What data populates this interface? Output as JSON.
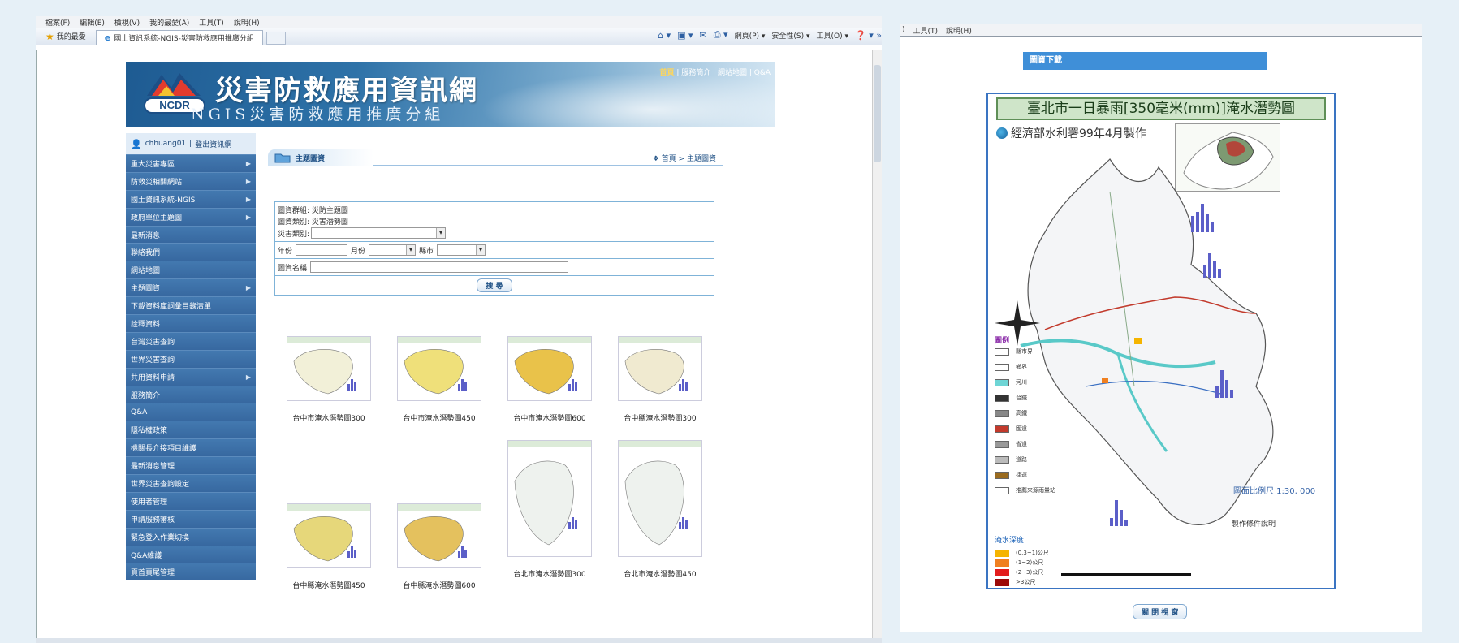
{
  "browser": {
    "menu": [
      "檔案(F)",
      "編輯(E)",
      "檢視(V)",
      "我的最愛(A)",
      "工具(T)",
      "說明(H)"
    ],
    "favorites_label": "我的最愛",
    "tab_title": "國土資訊系統-NGIS-災害防救應用推廣分組",
    "commands": [
      "網頁(P) ▾",
      "安全性(S) ▾",
      "工具(O) ▾"
    ]
  },
  "site": {
    "logo": "NCDR",
    "title": "災害防救應用資訊網",
    "subtitle": "NGIS災害防救應用推廣分組",
    "top_links": {
      "home": "首頁",
      "rest": " | 服務簡介 | 網站地圖 | Q&A"
    }
  },
  "sidebar": {
    "user": "chhuang01",
    "logout": "登出資訊網",
    "items": [
      {
        "label": "重大災害專區",
        "arrow": true
      },
      {
        "label": "防救災相關網站",
        "arrow": true
      },
      {
        "label": "國土資訊系統-NGIS",
        "arrow": true
      },
      {
        "label": "政府單位主題圖",
        "arrow": true
      },
      {
        "label": "最新消息",
        "arrow": false
      },
      {
        "label": "聯絡我們",
        "arrow": false
      },
      {
        "label": "網站地圖",
        "arrow": false
      },
      {
        "label": "主題圖資",
        "arrow": true
      },
      {
        "label": "下載資料庫詞彙目錄清單",
        "arrow": false
      },
      {
        "label": "詮釋資料",
        "arrow": false
      },
      {
        "label": "台灣災害查詢",
        "arrow": false
      },
      {
        "label": "世界災害查詢",
        "arrow": false
      },
      {
        "label": "共用資料申請",
        "arrow": true
      },
      {
        "label": "服務簡介",
        "arrow": false
      },
      {
        "label": "Q&A",
        "arrow": false
      },
      {
        "label": "隱私權政策",
        "arrow": false
      },
      {
        "label": "機關長介接項目維護",
        "arrow": false
      },
      {
        "label": "最新消息管理",
        "arrow": false
      },
      {
        "label": "世界災害查詢設定",
        "arrow": false
      },
      {
        "label": "使用者管理",
        "arrow": false
      },
      {
        "label": "申請服務審核",
        "arrow": false
      },
      {
        "label": "緊急登入作業切換",
        "arrow": false
      },
      {
        "label": "Q&A維護",
        "arrow": false
      },
      {
        "label": "頁首頁尾管理",
        "arrow": false
      }
    ]
  },
  "main": {
    "section_tab": "主題圖資",
    "breadcrumb": "首頁 > 主題圖資",
    "form": {
      "group": "圖資群組: 災防主題圖",
      "category": "圖資類別: 災害潛勢圖",
      "hazard_label": "災害類別:",
      "year_label": "年份",
      "month_label": "月份",
      "county_label": "縣市",
      "name_label": "圖資名稱",
      "search_button": "搜 尋"
    },
    "results": [
      {
        "caption": "台中市淹水潛勢圖300",
        "tone": "#f2f0d8"
      },
      {
        "caption": "台中市淹水潛勢圖450",
        "tone": "#efe07a"
      },
      {
        "caption": "台中市淹水潛勢圖600",
        "tone": "#e9c24a"
      },
      {
        "caption": "台中縣淹水潛勢圖300",
        "tone": "#f0ead0"
      },
      {
        "caption": "台中縣淹水潛勢圖450",
        "tone": "#e6d77a"
      },
      {
        "caption": "台中縣淹水潛勢圖600",
        "tone": "#e4c15e"
      },
      {
        "caption": "台北市淹水潛勢圖300",
        "tone": "#eef2ee"
      },
      {
        "caption": "台北市淹水潛勢圖450",
        "tone": "#eef2ee"
      }
    ]
  },
  "popup": {
    "menu": [
      "工具(T)",
      "說明(H)"
    ],
    "download_title": "圖資下載",
    "map_title": "臺北市一日暴雨[350毫米(mm)]淹水潛勢圖",
    "agency": "經濟部水利署99年4月製作",
    "legend_title": "圖例",
    "depth_title": "淹水深度",
    "depth_items": [
      {
        "label": "(0.3~1)公尺",
        "color": "#f5b400"
      },
      {
        "label": "(1~2)公尺",
        "color": "#f08020"
      },
      {
        "label": "(2~3)公尺",
        "color": "#e31d1d"
      },
      {
        "label": ">3公尺",
        "color": "#9c0a0a"
      }
    ],
    "legend_items": [
      "縣市界",
      "鄉界",
      "河川",
      "台鐵",
      "高鐵",
      "國道",
      "省道",
      "道路",
      "捷運",
      "推薦來源雨量站"
    ],
    "scale": "圖面比例尺 1:30, 000",
    "conditions": "製作條件說明",
    "close_button": "關 閉 視 窗"
  }
}
